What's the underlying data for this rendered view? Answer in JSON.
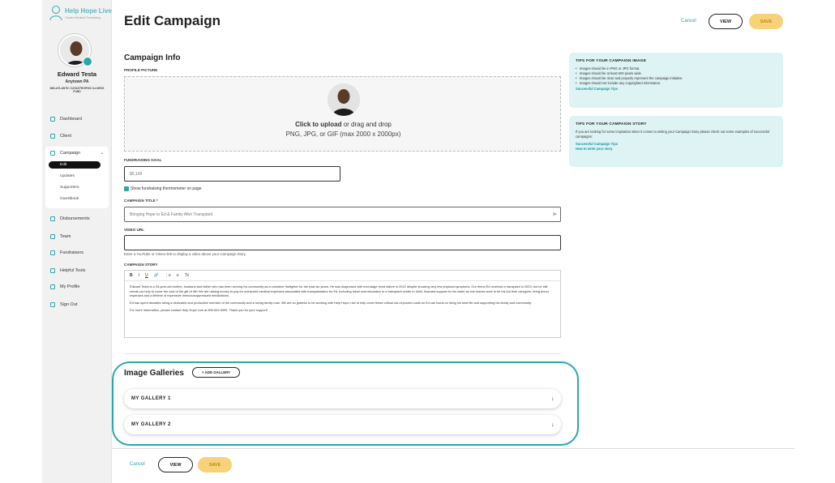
{
  "app": {
    "logo_name": "Help Hope Live",
    "logo_tagline": "Trusted Medical Fundraising"
  },
  "user": {
    "name": "Edward Testa",
    "location": "Anytown PA",
    "fund": "MID-ATLANTIC CATASTROPHIC ILLNESS FUND"
  },
  "nav": {
    "dashboard": "Dashboard",
    "client": "Client",
    "campaign": "Campaign",
    "sub": {
      "edit": "Edit",
      "updates": "Updates",
      "supporters": "Supporters",
      "guestbook": "Guestbook"
    },
    "disbursements": "Disbursements",
    "team": "Team",
    "fundraisers": "Fundraisers",
    "helpful_tools": "Helpful Tools",
    "my_profile": "My Profile",
    "sign_out": "Sign Out"
  },
  "header": {
    "title": "Edit Campaign",
    "cancel": "Cancel",
    "view": "VIEW",
    "save": "SAVE"
  },
  "form": {
    "section_title": "Campaign Info",
    "profile_picture_label": "PROFILE PICTURE",
    "upload_strong": "Click to upload",
    "upload_rest": " or drag and drop",
    "upload_formats": "PNG, JPG, or GIF (max 2000 x 2000px)",
    "goal_label": "FUNDRAISING GOAL",
    "goal_value": "$5,100",
    "thermometer_label": "Show fundraising thermometer on page",
    "title_label": "CAMPAIGN TITLE *",
    "title_value": "Bringing Hope to Ed & Family After Transplant",
    "video_label": "VIDEO URL",
    "video_value": "",
    "video_help": "Enter a YouTube or Vimeo link to display a video above your Campaign Story.",
    "story_label": "CAMPAIGN STORY",
    "story_p1": "Edward Testa is a 33-year-old brother, husband and father who has been serving his community as a volunteer firefighter for the past six years. He was diagnosed with end-stage renal failure in 2012 despite showing very few physical symptoms. Our friend Ed received a transplant in 2023, but he still needs our help to cover the cost of the gift of life! We are raising money to pay for uninsured medical expenses associated with transplantation for Ed, including travel and relocation to a transplant center in Utah, financial support for his sister as she leaves work to be his full-time caregiver, living donor expenses and a lifetime of expensive immunosuppressant medications.",
    "story_p2": "Ed has spent decades being a dedicated and productive member of the community and a loving family man. We are so grateful to be working with Help Hope Live to help cover these critical out-of-pocket costs so Ed can focus on living his best life and supporting his family and community.",
    "story_p3": "For more information, please contact Help Hope Live at 800.642.8399. Thank you for your support!"
  },
  "toolbar": {
    "bold": "B",
    "italic": "I",
    "underline": "U",
    "link": "🔗",
    "ol": "⋮≡",
    "ul": "≡",
    "clear": "Tx"
  },
  "galleries": {
    "title": "Image Galleries",
    "add_button": "+ ADD GALLERY",
    "items": [
      "MY GALLERY 1",
      "MY GALLERY 2"
    ]
  },
  "footer": {
    "cancel": "Cancel",
    "view": "VIEW",
    "save": "SAVE"
  },
  "tips_image": {
    "title": "TIPS FOR YOUR CAMPAIGN IMAGE",
    "items": [
      "Images should be in PNG or JPG format.",
      "Images should be at least 600 pixels wide.",
      "Images should be clear and properly represent the campaign initiative.",
      "Images should not include any copyrighted information."
    ],
    "link": "Successful Campaign Tips"
  },
  "tips_story": {
    "title": "TIPS FOR YOUR CAMPAIGN STORY",
    "text": "If you are looking for some inspiration when it comes to writing your Campaign Story please check out some examples of successful campaigns:",
    "link1": "Successful Campaign Tips",
    "link2": "How to write your story"
  },
  "colors": {
    "accent": "#2aa7ad",
    "save": "#f8d27a",
    "tip_bg": "#def3f3"
  }
}
